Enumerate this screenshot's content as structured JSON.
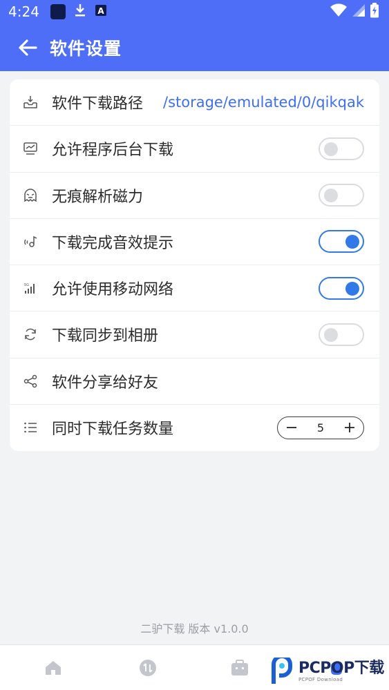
{
  "status_bar": {
    "time": "4:24",
    "icons": [
      "app-square-icon",
      "download-icon",
      "font-a-icon",
      "wifi-icon",
      "signal-icon",
      "battery-charging-icon"
    ]
  },
  "app_bar": {
    "back_icon": "arrow-left-icon",
    "title": "软件设置"
  },
  "settings": {
    "download_path": {
      "label": "软件下载路径",
      "value": "/storage/emulated/0/qikqak",
      "icon": "download-tray-icon"
    },
    "background_download": {
      "label": "允许程序后台下载",
      "enabled": false,
      "icon": "monitor-chart-icon"
    },
    "incognito_magnet": {
      "label": "无痕解析磁力",
      "enabled": false,
      "icon": "ghost-mask-icon"
    },
    "complete_sound": {
      "label": "下载完成音效提示",
      "enabled": true,
      "icon": "sound-wave-icon"
    },
    "mobile_network": {
      "label": "允许使用移动网络",
      "enabled": true,
      "icon": "signal-bars-icon"
    },
    "sync_album": {
      "label": "下载同步到相册",
      "enabled": false,
      "icon": "sync-icon"
    },
    "share": {
      "label": "软件分享给好友",
      "icon": "share-icon"
    },
    "concurrent": {
      "label": "同时下载任务数量",
      "value": "5",
      "minus": "−",
      "plus": "+",
      "icon": "list-icon"
    }
  },
  "footer": {
    "version": "二驴下载 版本 v1.0.0"
  },
  "bottom_nav": [
    "home-icon",
    "transfer-icon",
    "toolbox-icon",
    "profile-icon"
  ],
  "watermark": {
    "main": "PCPOP下载",
    "sub": "PCPOF Download"
  },
  "colors": {
    "primary": "#4f6ef7",
    "accent": "#3079e6",
    "link": "#3d6ef5"
  }
}
